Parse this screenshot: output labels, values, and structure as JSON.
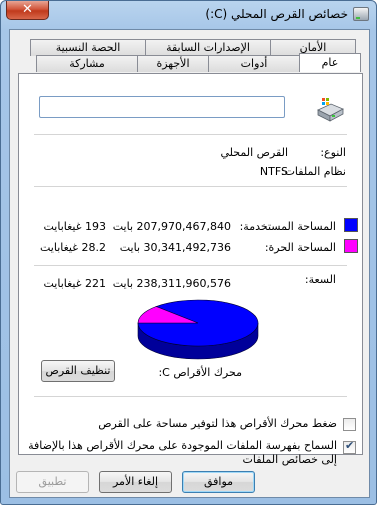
{
  "window": {
    "title": "خصائص القرص المحلي (C:)",
    "close_glyph": "✕"
  },
  "tabs": {
    "back_row": [
      "الأمان",
      "الإصدارات السابقة",
      "الحصة النسبية"
    ],
    "front_row": [
      "عام",
      "أدوات",
      "الأجهزة",
      "مشاركة"
    ],
    "active": "عام"
  },
  "general": {
    "drive_label_value": "",
    "type_label": "النوع:",
    "type_value": "القرص المحلي",
    "fs_label": "نظام الملفات:",
    "fs_value": "NTFS",
    "used_label": "المساحة المستخدمة:",
    "used_bytes": "207,970,467,840 بايت",
    "used_gb": "193 غيغابايت",
    "free_label": "المساحة الحرة:",
    "free_bytes": "30,341,492,736 بايت",
    "free_gb": "28.2 غيغابايت",
    "capacity_label": "السعة:",
    "capacity_bytes": "238,311,960,576 بايت",
    "capacity_gb": "221 غيغابايت",
    "drive_caption": "محرك الأقراص C:",
    "cleanup_button": "تنظيف القرص",
    "compress_option": "ضغط محرك الأقراص هذا لتوفير مساحة على القرص",
    "index_option_line1": "السماح بفهرسة الملفات الموجودة على محرك الأقراص هذا بالإضافة",
    "index_option_line2": "إلى خصائص الملفات",
    "compress_checked": false,
    "index_checked": true
  },
  "colors": {
    "used": "#0000ff",
    "free": "#ff00ff"
  },
  "chart_data": {
    "type": "pie",
    "categories": [
      "المساحة المستخدمة",
      "المساحة الحرة"
    ],
    "values": [
      207970467840,
      30341492736
    ]
  },
  "buttons": {
    "ok": "موافق",
    "cancel": "إلغاء الأمر",
    "apply": "تطبيق"
  },
  "icons": {
    "title": "drive-icon",
    "drive": "hard-drive-icon",
    "close": "close-icon"
  }
}
